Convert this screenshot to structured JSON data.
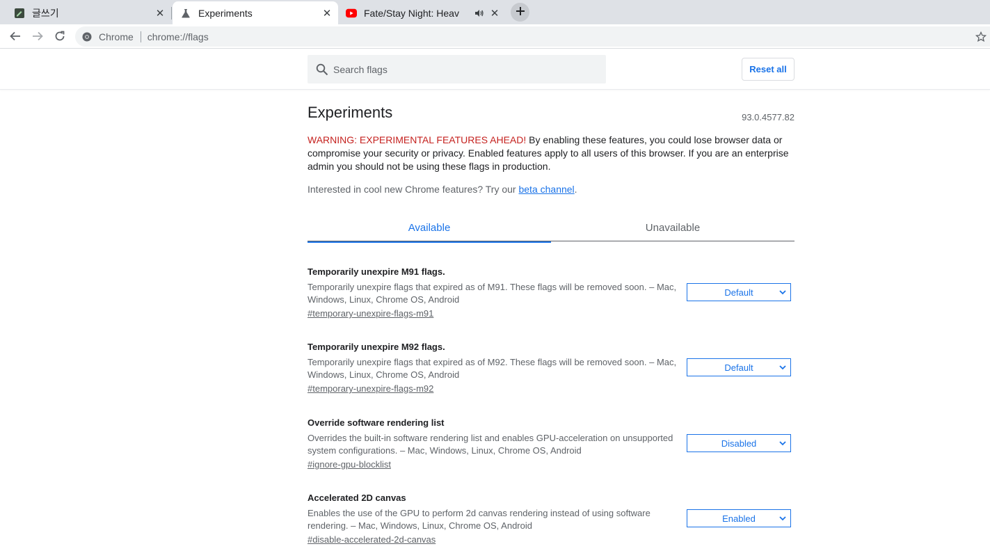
{
  "tabs": [
    {
      "title": "글쓰기",
      "favicon": "editor-icon",
      "active": false
    },
    {
      "title": "Experiments",
      "favicon": "flask-icon",
      "active": true
    },
    {
      "title": "Fate/Stay Night: Heav",
      "favicon": "youtube-icon",
      "active": false,
      "audio": true
    }
  ],
  "toolbar": {
    "site_chip": "Chrome",
    "url": "chrome://flags"
  },
  "header": {
    "search_placeholder": "Search flags",
    "reset_label": "Reset all"
  },
  "page": {
    "title": "Experiments",
    "version": "93.0.4577.82",
    "warning_prefix": "WARNING: EXPERIMENTAL FEATURES AHEAD!",
    "warning_body": " By enabling these features, you could lose browser data or compromise your security or privacy. Enabled features apply to all users of this browser. If you are an enterprise admin you should not be using these flags in production.",
    "promo_text": "Interested in cool new Chrome features? Try our ",
    "promo_link": "beta channel",
    "promo_suffix": "."
  },
  "flag_tabs": [
    {
      "label": "Available",
      "selected": true
    },
    {
      "label": "Unavailable",
      "selected": false
    }
  ],
  "experiments": [
    {
      "title": "Temporarily unexpire M91 flags.",
      "description": "Temporarily unexpire flags that expired as of M91. These flags will be removed soon. – Mac, Windows, Linux, Chrome OS, Android",
      "link": "#temporary-unexpire-flags-m91",
      "value": "Default"
    },
    {
      "title": "Temporarily unexpire M92 flags.",
      "description": "Temporarily unexpire flags that expired as of M92. These flags will be removed soon. – Mac, Windows, Linux, Chrome OS, Android",
      "link": "#temporary-unexpire-flags-m92",
      "value": "Default"
    },
    {
      "title": "Override software rendering list",
      "description": "Overrides the built-in software rendering list and enables GPU-acceleration on unsupported system configurations. – Mac, Windows, Linux, Chrome OS, Android",
      "link": "#ignore-gpu-blocklist",
      "value": "Disabled"
    },
    {
      "title": "Accelerated 2D canvas",
      "description": "Enables the use of the GPU to perform 2d canvas rendering instead of using software rendering. – Mac, Windows, Linux, Chrome OS, Android",
      "link": "#disable-accelerated-2d-canvas",
      "value": "Enabled"
    }
  ],
  "colors": {
    "accent": "#1a73e8",
    "warning": "#c5221f",
    "tabstrip": "#dee1e6"
  }
}
